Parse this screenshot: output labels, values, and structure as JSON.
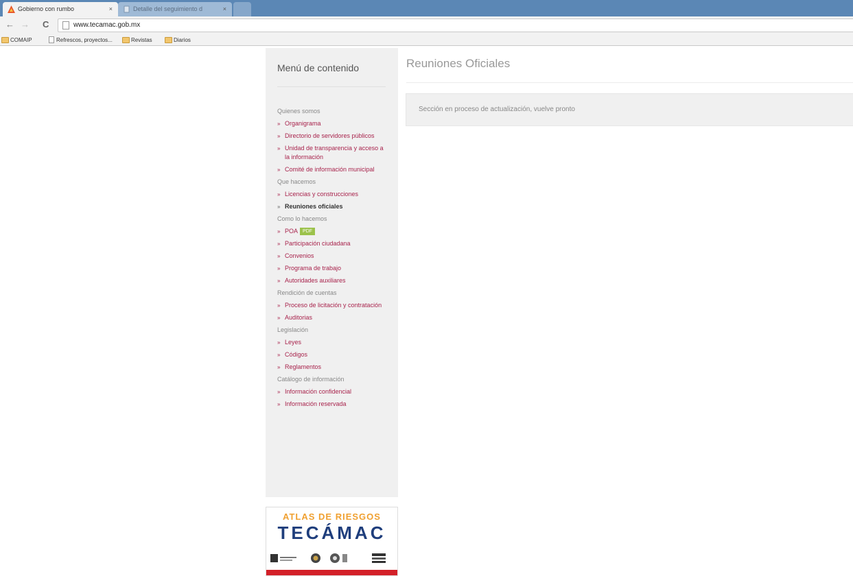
{
  "browser": {
    "tabs": [
      {
        "title": "Gobierno con rumbo",
        "close": "×"
      },
      {
        "title": "Detalle del seguimiento d",
        "close": "×"
      }
    ],
    "url": "www.tecamac.gob.mx",
    "nav": {
      "back": "←",
      "forward": "→",
      "reload": "C"
    },
    "bookmarks": [
      {
        "label": "COMAIP",
        "icon": "folder-icon"
      },
      {
        "label": "Refrescos, proyectos...",
        "icon": "page-icon"
      },
      {
        "label": "Revistas",
        "icon": "folder-icon"
      },
      {
        "label": "Diarios",
        "icon": "folder-icon"
      }
    ]
  },
  "sidebar": {
    "title": "Menú de contenido",
    "sections": [
      {
        "label": "Quienes somos",
        "items": [
          "Organigrama",
          "Directorio de servidores públicos",
          "Unidad de transparencia y acceso a la información",
          "Comité de información municipal"
        ]
      },
      {
        "label": "Que hacemos",
        "items": [
          "Licencias y construcciones",
          "Reuniones oficiales"
        ]
      },
      {
        "label": "Como lo hacemos",
        "items": [
          "POA",
          "Participación ciudadana",
          "Convenios",
          "Programa de trabajo",
          "Autoridades auxiliares"
        ]
      },
      {
        "label": "Rendición de cuentas",
        "items": [
          "Proceso de licitación y contratación",
          "Auditorias"
        ]
      },
      {
        "label": "Legislación",
        "items": [
          "Leyes",
          "Códigos",
          "Reglamentos"
        ]
      },
      {
        "label": "Catálogo de información",
        "items": [
          "Información confidencial",
          "Información reservada"
        ]
      }
    ],
    "poa_badge": "PDF",
    "current_item": "Reuniones oficiales"
  },
  "main": {
    "title": "Reuniones Oficiales",
    "notice": "Sección en proceso de actualización, vuelve pronto"
  },
  "banner": {
    "line1": "ATLAS DE RIESGOS",
    "line2": "TECÁMAC",
    "colors": {
      "orange": "#f0a030",
      "blue": "#1f3e7c",
      "red": "#d32028"
    }
  },
  "colors": {
    "link": "#a8234c",
    "tabstrip": "#5b87b5",
    "badge": "#9cc24b"
  }
}
